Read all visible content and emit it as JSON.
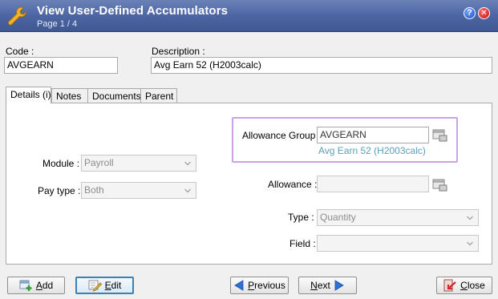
{
  "window": {
    "title": "View User-Defined Accumulators",
    "subtitle": "Page 1 / 4",
    "help_label": "?",
    "close_label": "✕"
  },
  "header": {
    "code_label": "Code :",
    "code_value": "AVGEARN",
    "description_label": "Description :",
    "description_value": "Avg Earn 52 (H2003calc)"
  },
  "tabs": [
    {
      "label": "Details (i)",
      "active": true
    },
    {
      "label": "Notes",
      "active": false
    },
    {
      "label": "Documents",
      "active": false
    },
    {
      "label": "Parent",
      "active": false
    }
  ],
  "details": {
    "allowance_group_label": "Allowance Group :",
    "allowance_group_value": "AVGEARN",
    "allowance_group_description": "Avg Earn 52 (H2003calc)",
    "module_label": "Module :",
    "module_value": "Payroll",
    "pay_type_label": "Pay type :",
    "pay_type_value": "Both",
    "allowance_label": "Allowance :",
    "allowance_value": "",
    "type_label": "Type :",
    "type_value": "Quantity",
    "field_label": "Field :",
    "field_value": ""
  },
  "buttons": {
    "add_first": "A",
    "add_rest": "dd",
    "edit_first": "E",
    "edit_rest": "dit",
    "previous_first": "P",
    "previous_rest": "revious",
    "next_first": "N",
    "next_rest": "ext",
    "close_first": "C",
    "close_rest": "lose"
  },
  "colors": {
    "titlebar": "#4d66a3",
    "highlight_border": "#c9a3e6",
    "link_text": "#5aa0b8",
    "focus_border": "#3c7fb1"
  },
  "icons": {
    "app": "wrench-icon",
    "lookup": "lookup-icon",
    "add": "add-icon",
    "edit": "edit-icon",
    "previous": "arrow-left-icon",
    "next": "arrow-right-icon",
    "close": "exit-icon"
  }
}
